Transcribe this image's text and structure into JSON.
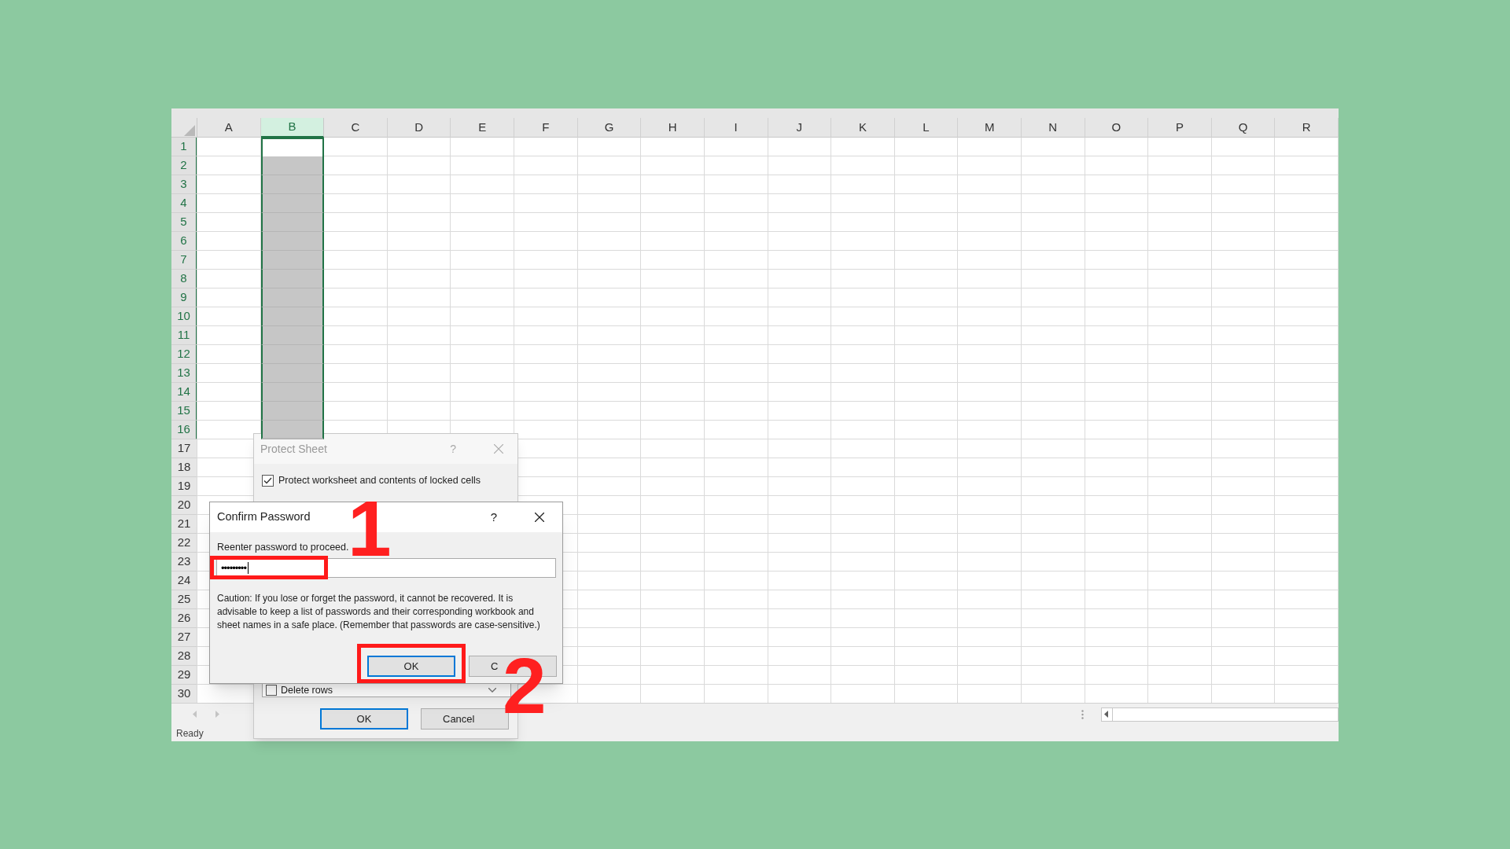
{
  "sheet": {
    "columns": [
      {
        "label": "A",
        "selected": false
      },
      {
        "label": "B",
        "selected": true
      },
      {
        "label": "C",
        "selected": false
      },
      {
        "label": "D",
        "selected": false
      },
      {
        "label": "E",
        "selected": false
      },
      {
        "label": "F",
        "selected": false
      },
      {
        "label": "G",
        "selected": false
      },
      {
        "label": "H",
        "selected": false
      },
      {
        "label": "I",
        "selected": false
      },
      {
        "label": "J",
        "selected": false
      },
      {
        "label": "K",
        "selected": false
      },
      {
        "label": "L",
        "selected": false
      },
      {
        "label": "M",
        "selected": false
      },
      {
        "label": "N",
        "selected": false
      },
      {
        "label": "O",
        "selected": false
      },
      {
        "label": "P",
        "selected": false
      },
      {
        "label": "Q",
        "selected": false
      },
      {
        "label": "R",
        "selected": false
      }
    ],
    "rows": [
      {
        "label": "1",
        "selected": true
      },
      {
        "label": "2",
        "selected": true
      },
      {
        "label": "3",
        "selected": true
      },
      {
        "label": "4",
        "selected": true
      },
      {
        "label": "5",
        "selected": true
      },
      {
        "label": "6",
        "selected": true
      },
      {
        "label": "7",
        "selected": true
      },
      {
        "label": "8",
        "selected": true
      },
      {
        "label": "9",
        "selected": true
      },
      {
        "label": "10",
        "selected": true
      },
      {
        "label": "11",
        "selected": true
      },
      {
        "label": "12",
        "selected": true
      },
      {
        "label": "13",
        "selected": true
      },
      {
        "label": "14",
        "selected": true
      },
      {
        "label": "15",
        "selected": true
      },
      {
        "label": "16",
        "selected": true
      },
      {
        "label": "17",
        "selected": false
      },
      {
        "label": "18",
        "selected": false
      },
      {
        "label": "19",
        "selected": false
      },
      {
        "label": "20",
        "selected": false
      },
      {
        "label": "21",
        "selected": false
      },
      {
        "label": "22",
        "selected": false
      },
      {
        "label": "23",
        "selected": false
      },
      {
        "label": "24",
        "selected": false
      },
      {
        "label": "25",
        "selected": false
      },
      {
        "label": "26",
        "selected": false
      },
      {
        "label": "27",
        "selected": false
      },
      {
        "label": "28",
        "selected": false
      },
      {
        "label": "29",
        "selected": false
      },
      {
        "label": "30",
        "selected": false
      }
    ]
  },
  "protect_dialog": {
    "title": "Protect Sheet",
    "help": "?",
    "option": {
      "label": "Protect worksheet and contents of locked cells",
      "checked": true
    },
    "permission": {
      "label": "Delete rows",
      "checked": false
    },
    "buttons": [
      {
        "label": "OK",
        "focused": true
      },
      {
        "label": "Cancel",
        "focused": false
      }
    ]
  },
  "confirm_dialog": {
    "title": "Confirm Password",
    "help": "?",
    "prompt": "Reenter password to proceed.",
    "password": {
      "value": "•••••••••"
    },
    "caution": "Caution: If you lose or forget the password, it cannot be recovered. It is advisable to keep a list of passwords and their corresponding workbook and sheet names in a safe place.  (Remember that passwords are case-sensitive.)",
    "buttons": [
      {
        "label": "OK",
        "focused": true
      },
      {
        "label": "C",
        "focused": false
      }
    ]
  },
  "annotations": [
    {
      "label": "1"
    },
    {
      "label": "2"
    }
  ],
  "status_bar": {
    "text": "Ready"
  }
}
